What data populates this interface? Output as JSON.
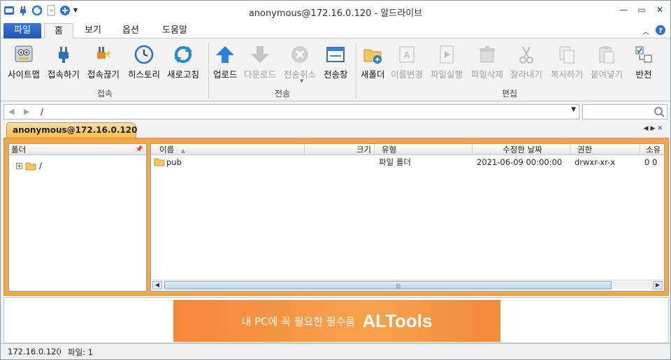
{
  "window": {
    "title": "anonymous@172.16.0.120 - 알드라이브"
  },
  "ribbon_tabs": {
    "file": "파일",
    "home": "홈",
    "view": "보기",
    "options": "옵션",
    "help": "도움말"
  },
  "groups": {
    "connect": {
      "label": "접속",
      "buttons": [
        "사이트맵",
        "접속하기",
        "접속끊기",
        "히스토리",
        "새로고침"
      ]
    },
    "transfer": {
      "label": "전송",
      "buttons": [
        "업로드",
        "다운로드",
        "전송취소",
        "전송창"
      ]
    },
    "edit": {
      "label": "편집",
      "buttons": [
        "새폴더",
        "이름변경",
        "파일실행",
        "파일삭제",
        "잘라내기",
        "복사하기",
        "붙여넣기",
        "반전"
      ]
    }
  },
  "address": {
    "path": "/"
  },
  "session_tab": "anonymous@172.16.0.120",
  "folder_pane": {
    "header": "폴더",
    "root": "/"
  },
  "file_list": {
    "columns": [
      "이름",
      "크기",
      "유형",
      "수정한 날짜",
      "권한",
      "소유"
    ],
    "rows": [
      {
        "name": "pub",
        "size": "",
        "type": "파일 폴더",
        "modified": "2021-06-09 00:00:00",
        "perm": "drwxr-xr-x",
        "owner": "0 0"
      }
    ]
  },
  "ad": {
    "text": "내 PC에 꼭 필요한 필수품",
    "brand": "ALTools"
  },
  "status": {
    "host": "172.16.0.120",
    "files": "파일: 1"
  },
  "colors": {
    "accent": "#1d55b5",
    "tab_orange": "#f6b94f",
    "frame_orange": "#f3a64a",
    "banner": "#f7a24b"
  }
}
